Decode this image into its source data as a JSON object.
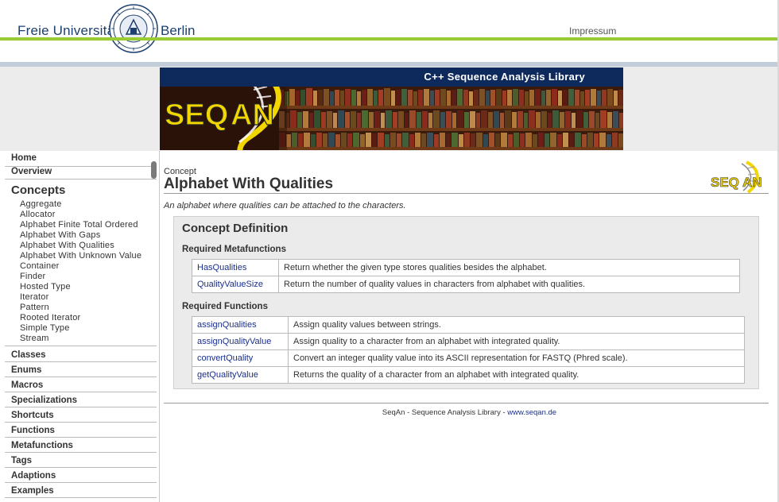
{
  "header": {
    "fu_name_left": "Freie Universität",
    "fu_name_right": "Berlin",
    "impressum": "Impressum",
    "seal_icon": "fu-berlin-seal-icon"
  },
  "banner": {
    "title": "C++ Sequence Analysis Library",
    "logo_text": "SEQAN"
  },
  "sidebar": {
    "home": "Home",
    "overview": "Overview",
    "concepts_heading": "Concepts",
    "concepts": [
      "Aggregate",
      "Allocator",
      "Alphabet Finite Total Ordered",
      "Alphabet With Gaps",
      "Alphabet With Qualities",
      "Alphabet With Unknown Value",
      "Container",
      "Finder",
      "Hosted Type",
      "Iterator",
      "Pattern",
      "Rooted Iterator",
      "Simple Type",
      "Stream"
    ],
    "sections": [
      "Classes",
      "Enums",
      "Macros",
      "Specializations",
      "Shortcuts",
      "Functions",
      "Metafunctions",
      "Tags",
      "Adaptions",
      "Examples"
    ]
  },
  "main": {
    "kicker": "Concept",
    "title": "Alphabet With Qualities",
    "description": "An alphabet where qualities can be attached to the characters.",
    "definition_heading": "Concept Definition",
    "metafunctions_heading": "Required Metafunctions",
    "metafunctions": [
      {
        "name": "HasQualities",
        "desc": "Return whether the given type stores qualities besides the alphabet."
      },
      {
        "name": "QualityValueSize",
        "desc": "Return the number of quality values in characters from alphabet with qualities."
      }
    ],
    "functions_heading": "Required Functions",
    "functions": [
      {
        "name": "assignQualities",
        "desc": "Assign quality values between strings."
      },
      {
        "name": "assignQualityValue",
        "desc": "Assign quality to a character from an alphabet with integrated quality."
      },
      {
        "name": "convertQuality",
        "desc": "Convert an integer quality value into its ASCII representation for FASTQ (Phred scale)."
      },
      {
        "name": "getQualityValue",
        "desc": "Returns the quality of a character from an alphabet with integrated quality."
      }
    ],
    "small_logo_text": "SEQAN"
  },
  "footer": {
    "text": "SeqAn - Sequence Analysis Library - ",
    "link": "www.seqan.de"
  },
  "colors": {
    "accent_green": "#99cc33",
    "banner_navy": "#0e2a5c",
    "link_blue": "#1a2f8c",
    "logo_yellow": "#f2d600"
  }
}
